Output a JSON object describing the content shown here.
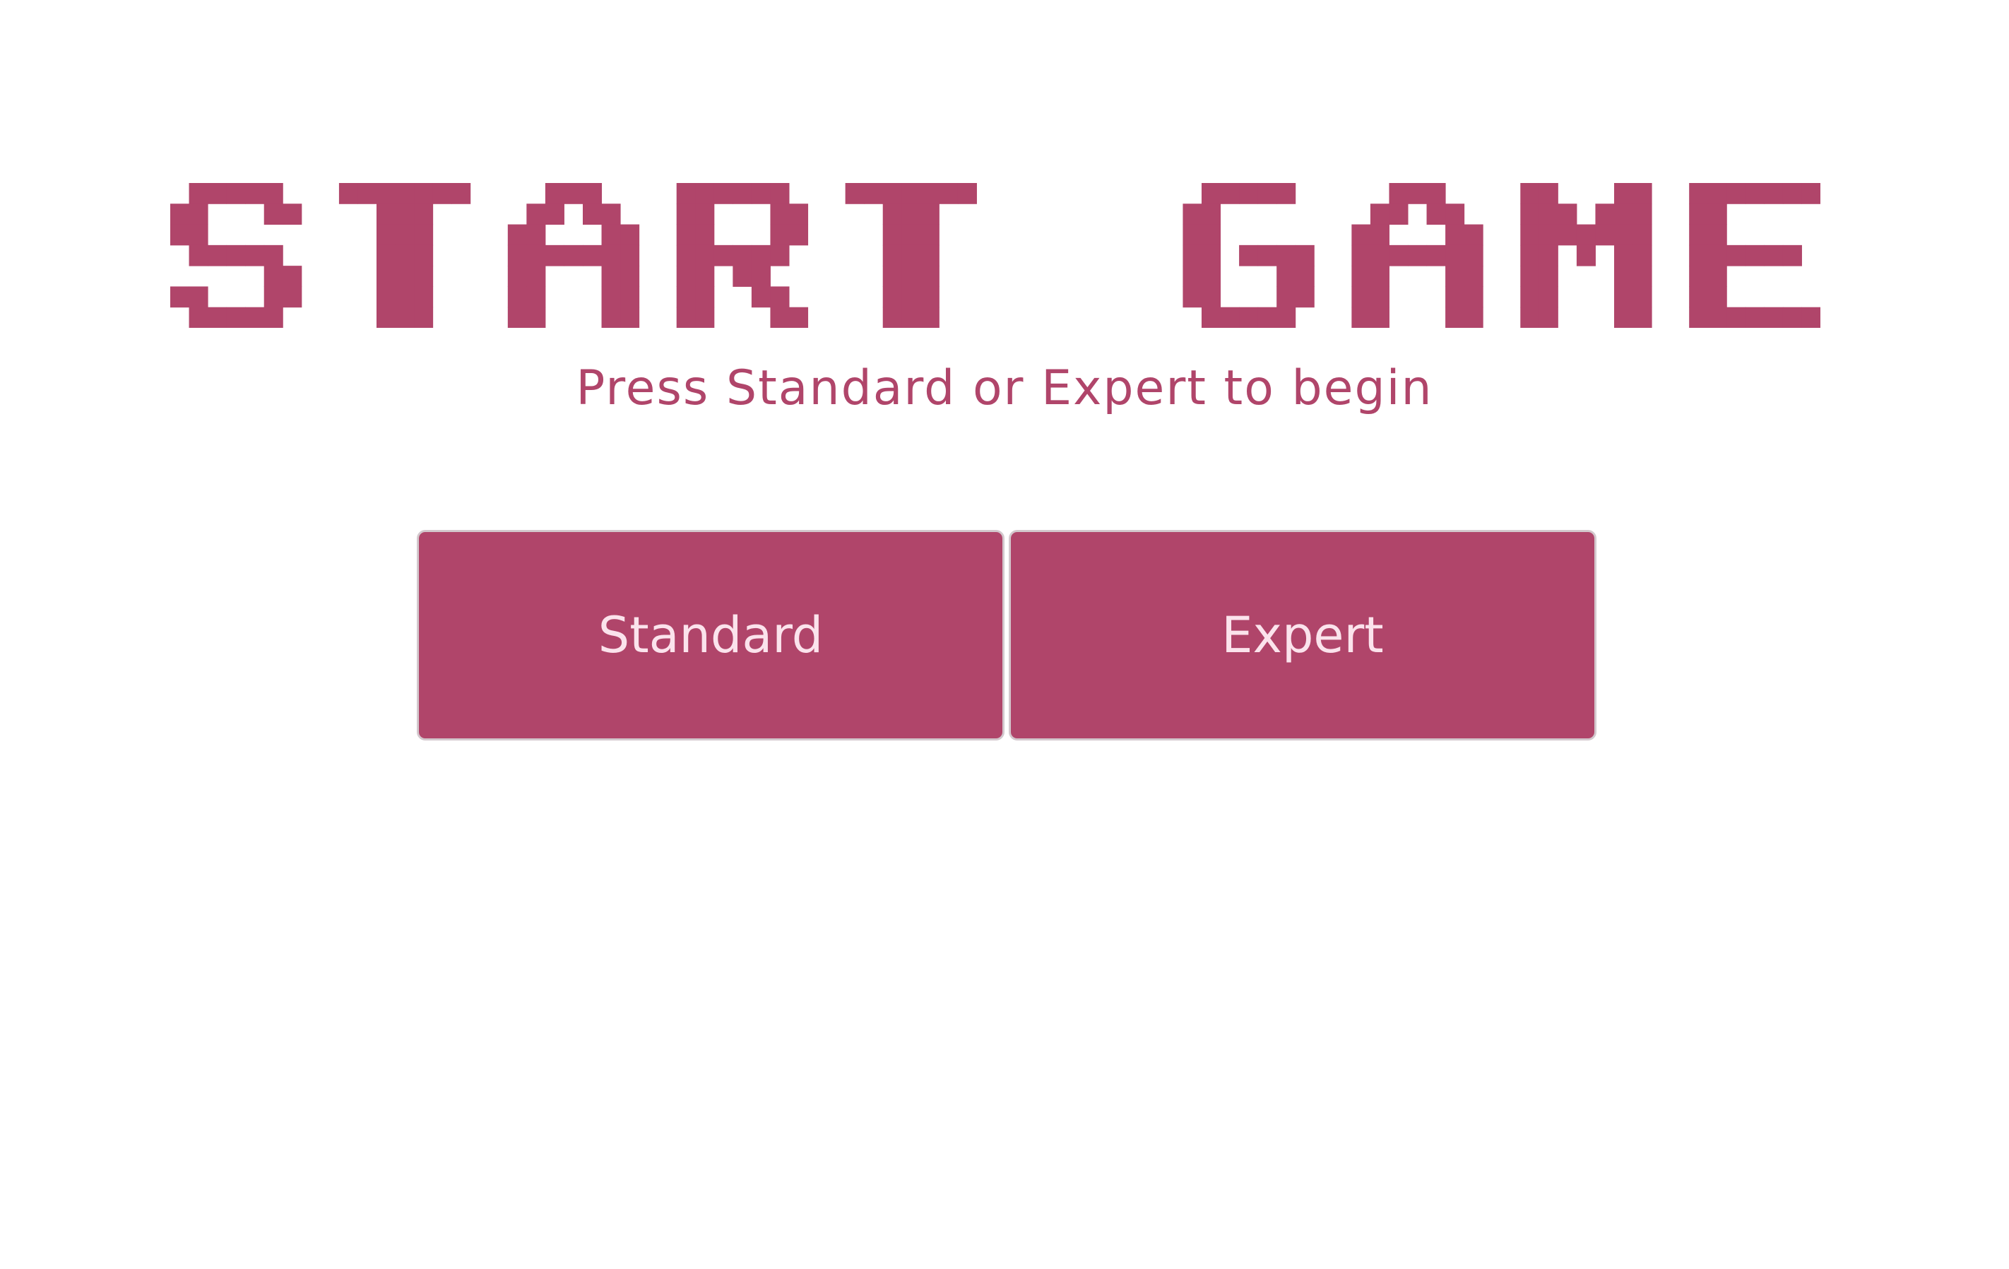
{
  "title": "START GAME",
  "subtitle": "Press Standard or Expert to begin",
  "buttons": {
    "standard_label": "Standard",
    "expert_label": "Expert"
  },
  "colors": {
    "accent": "#b0456a",
    "button_text": "#fbe3ec",
    "background": "#ffffff",
    "button_border": "#d3c8cd"
  }
}
